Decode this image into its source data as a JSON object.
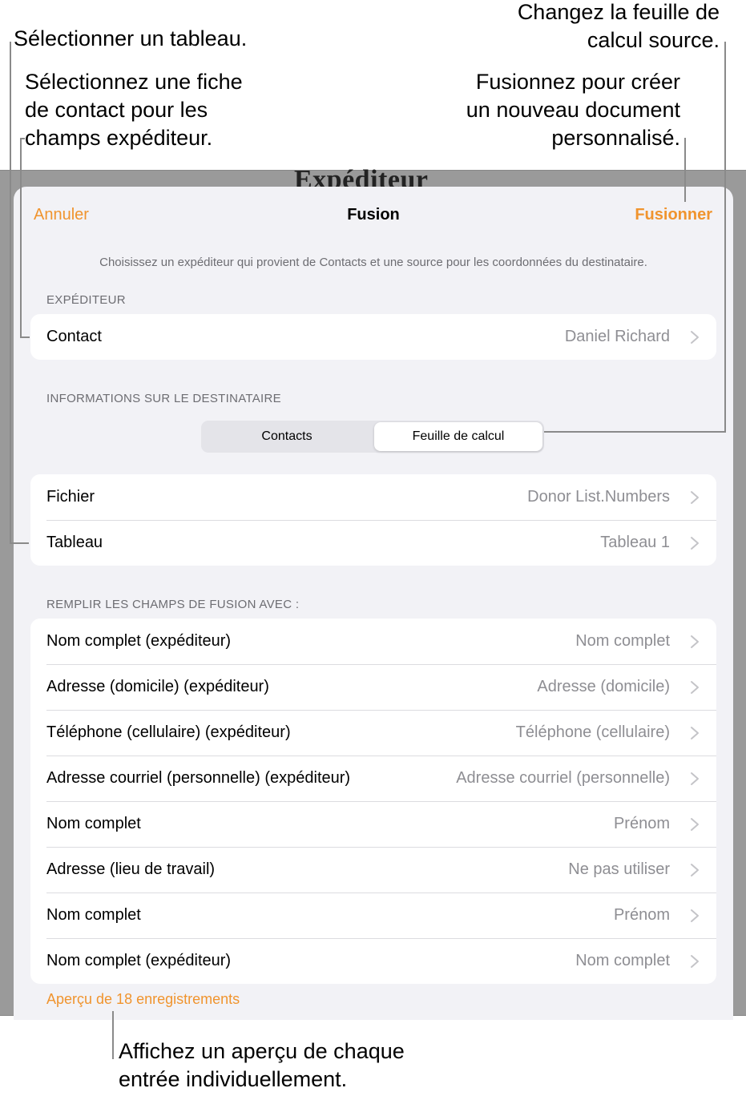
{
  "callouts": {
    "select_table": "Sélectionner un tableau.",
    "select_contact": [
      "Sélectionnez une fiche",
      "de contact pour les",
      "champs expéditeur."
    ],
    "change_sheet": [
      "Changez la feuille de",
      "calcul source."
    ],
    "merge_info": [
      "Fusionnez pour créer",
      "un nouveau document",
      "personnalisé."
    ],
    "preview_info": [
      "Affichez un aperçu de chaque",
      "entrée individuellement."
    ]
  },
  "background_doc_title": "Expéditeur",
  "nav": {
    "cancel": "Annuler",
    "title": "Fusion",
    "merge": "Fusionner"
  },
  "intro": "Choisissez un expéditeur qui provient de Contacts et une source pour les coordonnées du destinataire.",
  "sender": {
    "header": "EXPÉDITEUR",
    "row": {
      "label": "Contact",
      "value": "Daniel Richard"
    }
  },
  "recipient": {
    "header": "INFORMATIONS SUR LE DESTINATAIRE",
    "segments": [
      "Contacts",
      "Feuille de calcul"
    ],
    "selected_segment": "Feuille de calcul",
    "rows": [
      {
        "label": "Fichier",
        "value": "Donor List.Numbers"
      },
      {
        "label": "Tableau",
        "value": "Tableau 1"
      }
    ]
  },
  "fields": {
    "header": "REMPLIR LES CHAMPS DE FUSION AVEC :",
    "rows": [
      {
        "label": "Nom complet (expéditeur)",
        "value": "Nom complet"
      },
      {
        "label": "Adresse (domicile) (expéditeur)",
        "value": "Adresse (domicile)"
      },
      {
        "label": "Téléphone (cellulaire) (expéditeur)",
        "value": "Téléphone (cellulaire)"
      },
      {
        "label": "Adresse courriel (personnelle) (expéditeur)",
        "value": "Adresse courriel (personnelle)"
      },
      {
        "label": "Nom complet",
        "value": "Prénom"
      },
      {
        "label": "Adresse (lieu de travail)",
        "value": "Ne pas utiliser"
      },
      {
        "label": "Nom complet",
        "value": "Prénom"
      },
      {
        "label": "Nom complet (expéditeur)",
        "value": "Nom complet"
      }
    ]
  },
  "preview_link": "Aperçu de 18 enregistrements",
  "colors": {
    "accent": "#f0942e",
    "secondary_text": "#8e8e93",
    "sheet_bg": "#f2f2f6"
  }
}
